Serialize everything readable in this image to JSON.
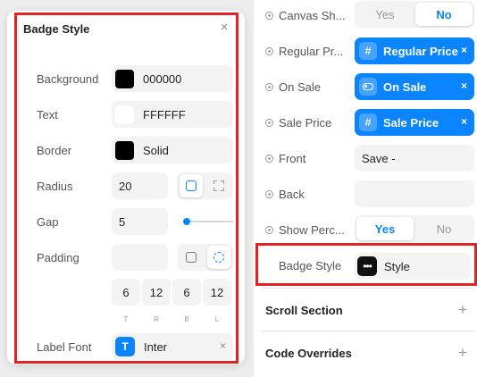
{
  "popover": {
    "title": "Badge Style",
    "close_icon": "×",
    "rows": {
      "background": {
        "label": "Background",
        "value": "000000",
        "color": "#000000"
      },
      "text": {
        "label": "Text",
        "value": "FFFFFF",
        "color": "#FFFFFF"
      },
      "border": {
        "label": "Border",
        "value": "Solid",
        "color": "#000000"
      },
      "radius": {
        "label": "Radius",
        "value": "20",
        "mode": "uniform"
      },
      "gap": {
        "label": "Gap",
        "value": "5",
        "slider_fraction": 0.08
      },
      "padding": {
        "label": "Padding",
        "mode": "individual",
        "values": [
          "6",
          "12",
          "6",
          "12"
        ],
        "sides": [
          "T",
          "R",
          "B",
          "L"
        ]
      },
      "label_font": {
        "label": "Label Font",
        "value": "Inter",
        "icon": "T"
      }
    }
  },
  "panel": {
    "canvas_show": {
      "label": "Canvas Sh...",
      "options": [
        "Yes",
        "No"
      ],
      "selected": "No"
    },
    "regular_price": {
      "label": "Regular Pr...",
      "value": "Regular Price",
      "icon": "#"
    },
    "on_sale": {
      "label": "On Sale",
      "value": "On Sale"
    },
    "sale_price": {
      "label": "Sale Price",
      "value": "Sale Price",
      "icon": "#"
    },
    "front": {
      "label": "Front",
      "value": "Save -"
    },
    "back": {
      "label": "Back",
      "value": ""
    },
    "show_percent": {
      "label": "Show Perc...",
      "options": [
        "Yes",
        "No"
      ],
      "selected": "Yes"
    },
    "badge_style": {
      "label": "Badge Style",
      "value": "Style",
      "icon": "•••"
    },
    "sections": [
      {
        "title": "Scroll Section",
        "action": "+"
      },
      {
        "title": "Code Overrides",
        "action": "+"
      }
    ],
    "chip_remove": "×"
  },
  "colors": {
    "accent": "#0a84ff",
    "highlight": "#e02424"
  }
}
